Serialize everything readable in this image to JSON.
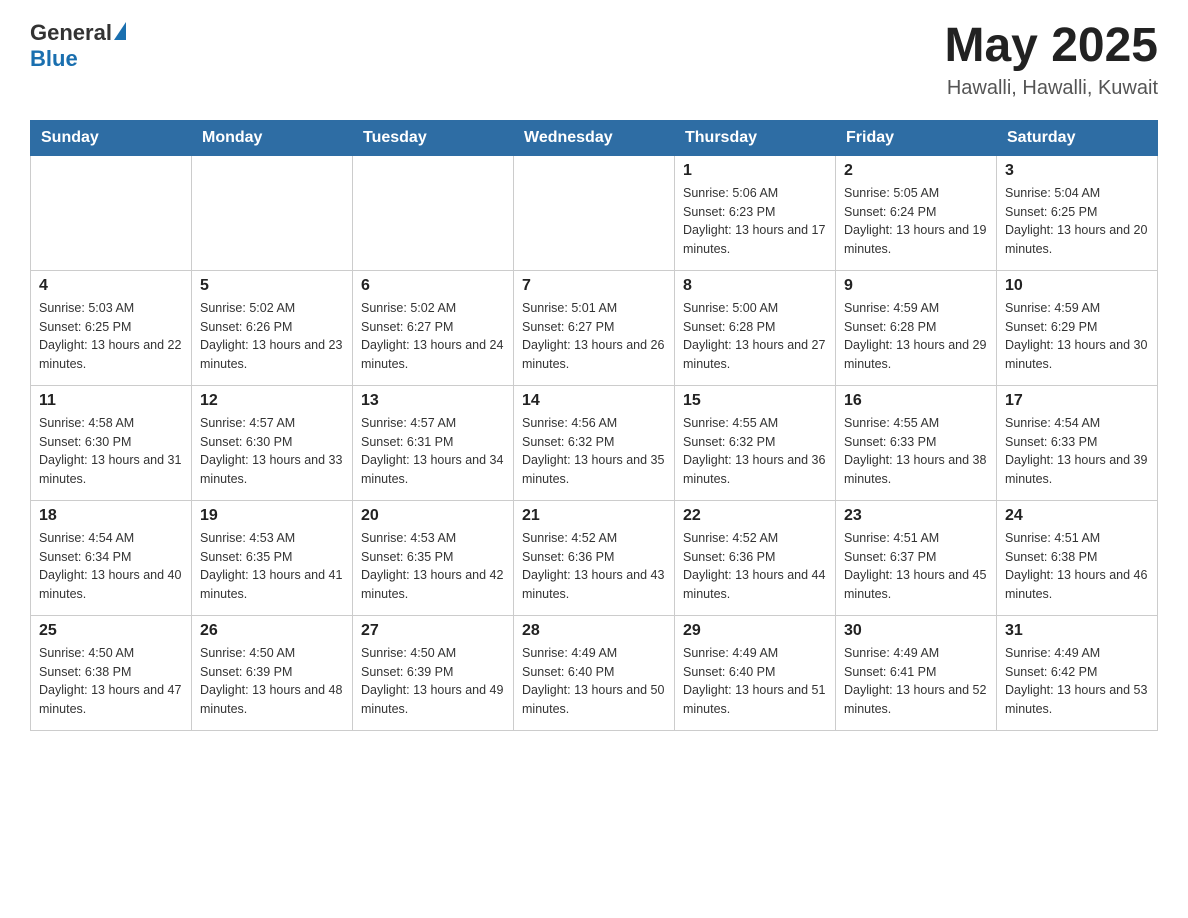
{
  "header": {
    "logo": {
      "general": "General",
      "blue": "Blue"
    },
    "title": "May 2025",
    "location": "Hawalli, Hawalli, Kuwait"
  },
  "weekdays": [
    "Sunday",
    "Monday",
    "Tuesday",
    "Wednesday",
    "Thursday",
    "Friday",
    "Saturday"
  ],
  "weeks": [
    [
      {
        "day": "",
        "info": ""
      },
      {
        "day": "",
        "info": ""
      },
      {
        "day": "",
        "info": ""
      },
      {
        "day": "",
        "info": ""
      },
      {
        "day": "1",
        "info": "Sunrise: 5:06 AM\nSunset: 6:23 PM\nDaylight: 13 hours and 17 minutes."
      },
      {
        "day": "2",
        "info": "Sunrise: 5:05 AM\nSunset: 6:24 PM\nDaylight: 13 hours and 19 minutes."
      },
      {
        "day": "3",
        "info": "Sunrise: 5:04 AM\nSunset: 6:25 PM\nDaylight: 13 hours and 20 minutes."
      }
    ],
    [
      {
        "day": "4",
        "info": "Sunrise: 5:03 AM\nSunset: 6:25 PM\nDaylight: 13 hours and 22 minutes."
      },
      {
        "day": "5",
        "info": "Sunrise: 5:02 AM\nSunset: 6:26 PM\nDaylight: 13 hours and 23 minutes."
      },
      {
        "day": "6",
        "info": "Sunrise: 5:02 AM\nSunset: 6:27 PM\nDaylight: 13 hours and 24 minutes."
      },
      {
        "day": "7",
        "info": "Sunrise: 5:01 AM\nSunset: 6:27 PM\nDaylight: 13 hours and 26 minutes."
      },
      {
        "day": "8",
        "info": "Sunrise: 5:00 AM\nSunset: 6:28 PM\nDaylight: 13 hours and 27 minutes."
      },
      {
        "day": "9",
        "info": "Sunrise: 4:59 AM\nSunset: 6:28 PM\nDaylight: 13 hours and 29 minutes."
      },
      {
        "day": "10",
        "info": "Sunrise: 4:59 AM\nSunset: 6:29 PM\nDaylight: 13 hours and 30 minutes."
      }
    ],
    [
      {
        "day": "11",
        "info": "Sunrise: 4:58 AM\nSunset: 6:30 PM\nDaylight: 13 hours and 31 minutes."
      },
      {
        "day": "12",
        "info": "Sunrise: 4:57 AM\nSunset: 6:30 PM\nDaylight: 13 hours and 33 minutes."
      },
      {
        "day": "13",
        "info": "Sunrise: 4:57 AM\nSunset: 6:31 PM\nDaylight: 13 hours and 34 minutes."
      },
      {
        "day": "14",
        "info": "Sunrise: 4:56 AM\nSunset: 6:32 PM\nDaylight: 13 hours and 35 minutes."
      },
      {
        "day": "15",
        "info": "Sunrise: 4:55 AM\nSunset: 6:32 PM\nDaylight: 13 hours and 36 minutes."
      },
      {
        "day": "16",
        "info": "Sunrise: 4:55 AM\nSunset: 6:33 PM\nDaylight: 13 hours and 38 minutes."
      },
      {
        "day": "17",
        "info": "Sunrise: 4:54 AM\nSunset: 6:33 PM\nDaylight: 13 hours and 39 minutes."
      }
    ],
    [
      {
        "day": "18",
        "info": "Sunrise: 4:54 AM\nSunset: 6:34 PM\nDaylight: 13 hours and 40 minutes."
      },
      {
        "day": "19",
        "info": "Sunrise: 4:53 AM\nSunset: 6:35 PM\nDaylight: 13 hours and 41 minutes."
      },
      {
        "day": "20",
        "info": "Sunrise: 4:53 AM\nSunset: 6:35 PM\nDaylight: 13 hours and 42 minutes."
      },
      {
        "day": "21",
        "info": "Sunrise: 4:52 AM\nSunset: 6:36 PM\nDaylight: 13 hours and 43 minutes."
      },
      {
        "day": "22",
        "info": "Sunrise: 4:52 AM\nSunset: 6:36 PM\nDaylight: 13 hours and 44 minutes."
      },
      {
        "day": "23",
        "info": "Sunrise: 4:51 AM\nSunset: 6:37 PM\nDaylight: 13 hours and 45 minutes."
      },
      {
        "day": "24",
        "info": "Sunrise: 4:51 AM\nSunset: 6:38 PM\nDaylight: 13 hours and 46 minutes."
      }
    ],
    [
      {
        "day": "25",
        "info": "Sunrise: 4:50 AM\nSunset: 6:38 PM\nDaylight: 13 hours and 47 minutes."
      },
      {
        "day": "26",
        "info": "Sunrise: 4:50 AM\nSunset: 6:39 PM\nDaylight: 13 hours and 48 minutes."
      },
      {
        "day": "27",
        "info": "Sunrise: 4:50 AM\nSunset: 6:39 PM\nDaylight: 13 hours and 49 minutes."
      },
      {
        "day": "28",
        "info": "Sunrise: 4:49 AM\nSunset: 6:40 PM\nDaylight: 13 hours and 50 minutes."
      },
      {
        "day": "29",
        "info": "Sunrise: 4:49 AM\nSunset: 6:40 PM\nDaylight: 13 hours and 51 minutes."
      },
      {
        "day": "30",
        "info": "Sunrise: 4:49 AM\nSunset: 6:41 PM\nDaylight: 13 hours and 52 minutes."
      },
      {
        "day": "31",
        "info": "Sunrise: 4:49 AM\nSunset: 6:42 PM\nDaylight: 13 hours and 53 minutes."
      }
    ]
  ]
}
